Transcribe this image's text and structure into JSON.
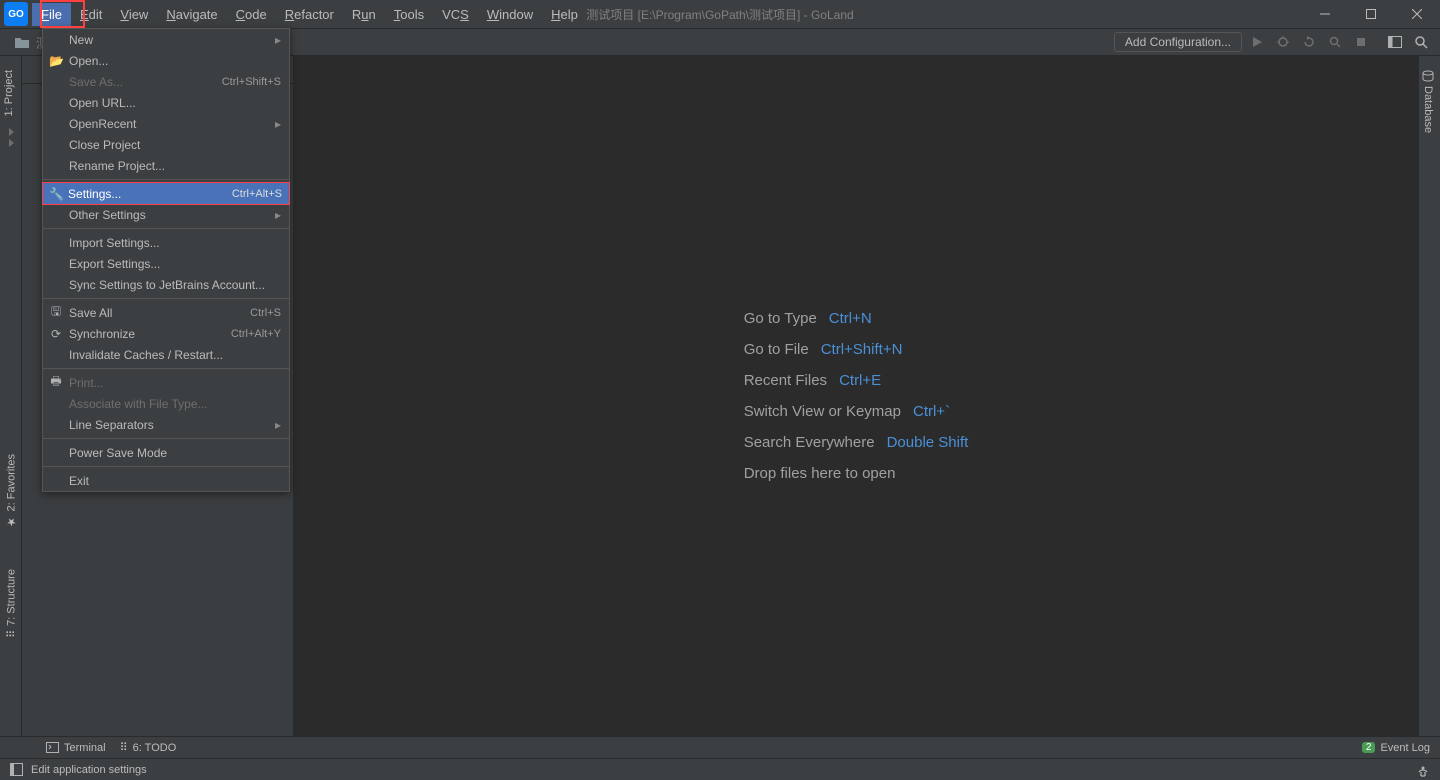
{
  "window": {
    "title": "测试项目 [E:\\Program\\GoPath\\测试项目] - GoLand",
    "app_badge": "GO"
  },
  "menu": {
    "items": [
      "File",
      "Edit",
      "View",
      "Navigate",
      "Code",
      "Refactor",
      "Run",
      "Tools",
      "VCS",
      "Window",
      "Help"
    ]
  },
  "toolbar": {
    "breadcrumb": "测",
    "add_config": "Add Configuration..."
  },
  "file_menu": {
    "new": "New",
    "open": "Open...",
    "save_as": "Save As...",
    "save_as_shortcut": "Ctrl+Shift+S",
    "open_url": "Open URL...",
    "open_recent": "Open Recent",
    "close_project": "Close Project",
    "rename_project": "Rename Project...",
    "settings": "Settings...",
    "settings_shortcut": "Ctrl+Alt+S",
    "other_settings": "Other Settings",
    "import_settings": "Import Settings...",
    "export_settings": "Export Settings...",
    "sync_settings": "Sync Settings to JetBrains Account...",
    "save_all": "Save All",
    "save_all_shortcut": "Ctrl+S",
    "synchronize": "Synchronize",
    "synchronize_shortcut": "Ctrl+Alt+Y",
    "invalidate": "Invalidate Caches / Restart...",
    "print": "Print...",
    "associate": "Associate with File Type...",
    "line_separators": "Line Separators",
    "power_save": "Power Save Mode",
    "exit": "Exit"
  },
  "shortcuts": [
    {
      "label": "Go to Type",
      "key": "Ctrl+N"
    },
    {
      "label": "Go to File",
      "key": "Ctrl+Shift+N"
    },
    {
      "label": "Recent Files",
      "key": "Ctrl+E"
    },
    {
      "label": "Switch View or Keymap",
      "key": "Ctrl+`"
    },
    {
      "label": "Search Everywhere",
      "key": "Double Shift"
    },
    {
      "label": "Drop files here to open",
      "key": ""
    }
  ],
  "left_tabs": {
    "project": "1: Project",
    "favorites": "2: Favorites",
    "structure": "7: Structure"
  },
  "right_tabs": {
    "database": "Database"
  },
  "bottom": {
    "terminal": "Terminal",
    "todo": "6: TODO",
    "event_log": "Event Log",
    "badge": "2"
  },
  "status": {
    "text": "Edit application settings"
  }
}
